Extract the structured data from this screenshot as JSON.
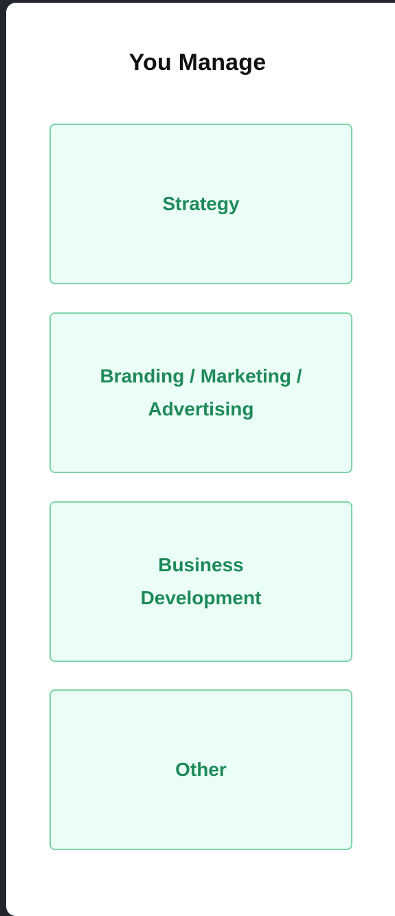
{
  "dialog": {
    "title": "You Manage",
    "options": [
      {
        "label": "Strategy"
      },
      {
        "label": "Branding / Marketing /\nAdvertising"
      },
      {
        "label": "Business\nDevelopment"
      },
      {
        "label": "Other"
      }
    ]
  },
  "colors": {
    "backdrop": "#22272e",
    "panel": "#ffffff",
    "option_background": "#eafdf6",
    "option_border": "#7dd3a8",
    "option_text": "#1e8a5a",
    "title_text": "#111111"
  }
}
